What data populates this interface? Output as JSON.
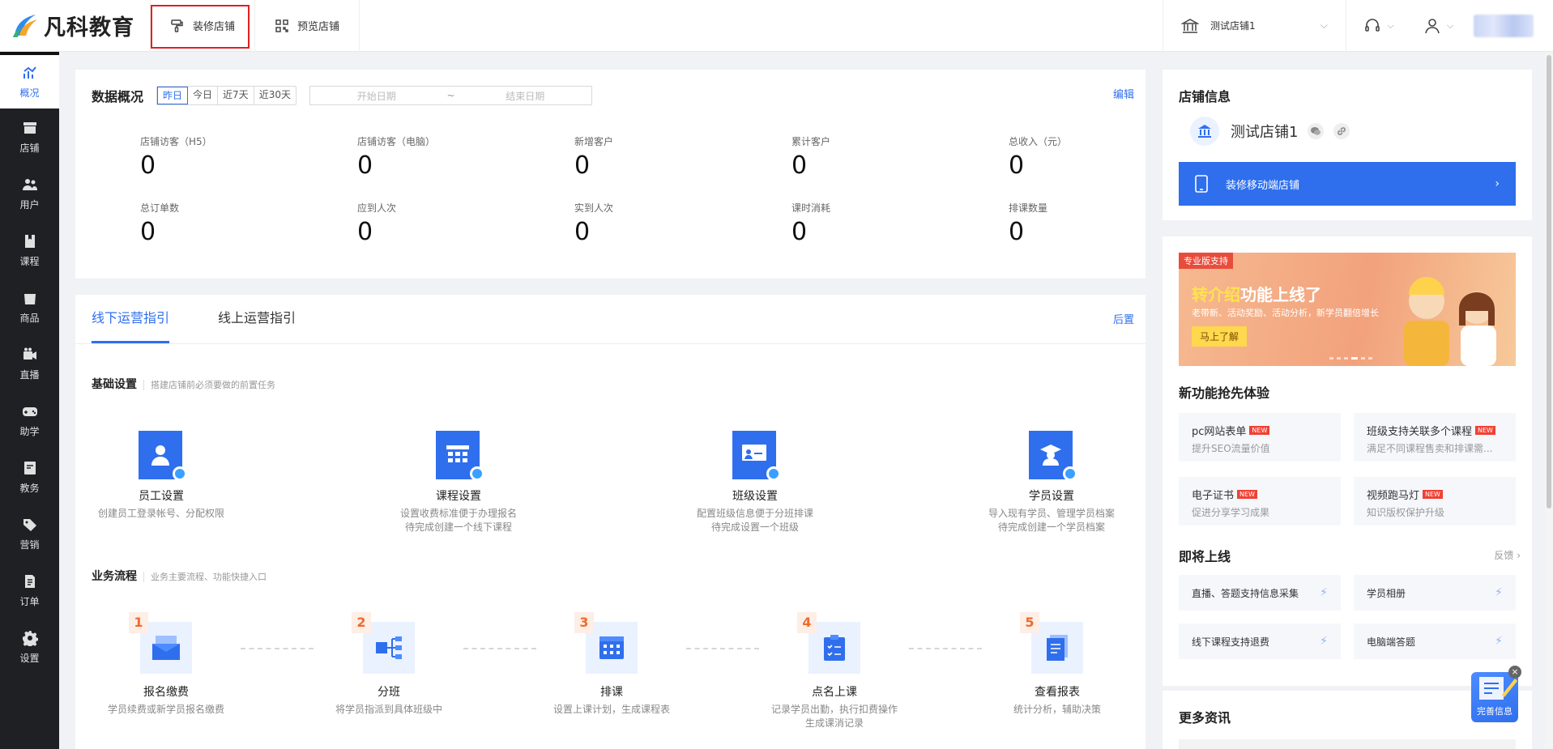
{
  "header": {
    "logo_text": "凡科教育",
    "tab_decorate": "装修店铺",
    "tab_preview": "预览店铺",
    "store_name": "测试店铺1"
  },
  "sidebar": {
    "items": [
      {
        "label": "概况",
        "icon": "chart-icon"
      },
      {
        "label": "店铺",
        "icon": "store-icon"
      },
      {
        "label": "用户",
        "icon": "users-icon"
      },
      {
        "label": "课程",
        "icon": "book-icon"
      },
      {
        "label": "商品",
        "icon": "bag-icon"
      },
      {
        "label": "直播",
        "icon": "video-icon"
      },
      {
        "label": "助学",
        "icon": "gamepad-icon"
      },
      {
        "label": "教务",
        "icon": "notebook-icon"
      },
      {
        "label": "营销",
        "icon": "tag-icon"
      },
      {
        "label": "订单",
        "icon": "order-icon"
      },
      {
        "label": "设置",
        "icon": "gear-icon"
      }
    ]
  },
  "overview": {
    "title": "数据概况",
    "date_tabs": [
      "昨日",
      "今日",
      "近7天",
      "近30天"
    ],
    "start_placeholder": "开始日期",
    "range_sep": "~",
    "end_placeholder": "结束日期",
    "edit": "编辑",
    "stats": [
      {
        "label": "店铺访客（H5）",
        "value": "0"
      },
      {
        "label": "店铺访客（电脑）",
        "value": "0"
      },
      {
        "label": "新增客户",
        "value": "0"
      },
      {
        "label": "累计客户",
        "value": "0"
      },
      {
        "label": "总收入（元）",
        "value": "0"
      },
      {
        "label": "总订单数",
        "value": "0"
      },
      {
        "label": "应到人次",
        "value": "0"
      },
      {
        "label": "实到人次",
        "value": "0"
      },
      {
        "label": "课时消耗",
        "value": "0"
      },
      {
        "label": "排课数量",
        "value": "0"
      }
    ]
  },
  "guide": {
    "tab_offline": "线下运营指引",
    "tab_online": "线上运营指引",
    "move_back": "后置",
    "basic_title": "基础设置",
    "basic_sub": "搭建店铺前必须要做的前置任务",
    "basic_items": [
      {
        "name": "员工设置",
        "desc1": "创建员工登录帐号、分配权限",
        "desc2": ""
      },
      {
        "name": "课程设置",
        "desc1": "设置收费标准便于办理报名",
        "desc2": "待完成创建一个线下课程"
      },
      {
        "name": "班级设置",
        "desc1": "配置班级信息便于分班排课",
        "desc2": "待完成设置一个班级"
      },
      {
        "name": "学员设置",
        "desc1": "导入现有学员、管理学员档案",
        "desc2": "待完成创建一个学员档案"
      }
    ],
    "flow_title": "业务流程",
    "flow_sub": "业务主要流程、功能快捷入口",
    "flow_items": [
      {
        "num": "1",
        "name": "报名缴费",
        "desc1": "学员续费或新学员报名缴费",
        "desc2": ""
      },
      {
        "num": "2",
        "name": "分班",
        "desc1": "将学员指派到具体班级中",
        "desc2": ""
      },
      {
        "num": "3",
        "name": "排课",
        "desc1": "设置上课计划，生成课程表",
        "desc2": ""
      },
      {
        "num": "4",
        "name": "点名上课",
        "desc1": "记录学员出勤，执行扣费操作",
        "desc2": "生成课消记录"
      },
      {
        "num": "5",
        "name": "查看报表",
        "desc1": "统计分析，辅助决策",
        "desc2": ""
      }
    ]
  },
  "store_info": {
    "title": "店铺信息",
    "name": "测试店铺1",
    "mobile_button": "装修移动端店铺"
  },
  "banner": {
    "tag": "专业版支持",
    "headline_hl": "转介绍",
    "headline": "功能上线了",
    "sub": "老带新、活动奖励、活动分析，新学员翻倍增长",
    "button": "马上了解"
  },
  "new_features": {
    "title": "新功能抢先体验",
    "new_badge": "NEW",
    "items": [
      {
        "title": "pc网站表单",
        "desc": "提升SEO流量价值"
      },
      {
        "title": "班级支持关联多个课程",
        "desc": "满足不同课程售卖和排课需..."
      },
      {
        "title": "电子证书",
        "desc": "促进分享学习成果"
      },
      {
        "title": "视频跑马灯",
        "desc": "知识版权保护升级"
      }
    ]
  },
  "coming_soon": {
    "title": "即将上线",
    "feedback": "反馈",
    "items": [
      "直播、答题支持信息采集",
      "学员相册",
      "线下课程支持退费",
      "电脑端答题"
    ]
  },
  "more_news": {
    "title": "更多资讯"
  },
  "float_widget": {
    "label": "完善信息",
    "close": "×"
  },
  "colors": {
    "primary": "#2f6fed",
    "sidebar_bg": "#1e2024",
    "highlight_border": "#e02020"
  }
}
